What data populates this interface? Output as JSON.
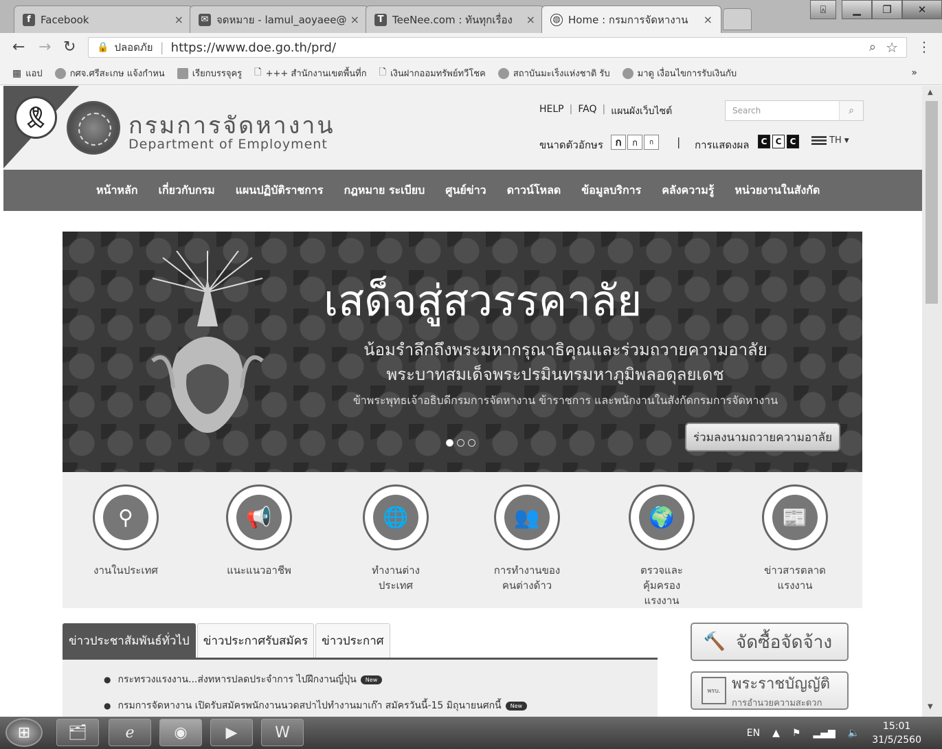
{
  "browser": {
    "tabs": [
      {
        "title": "Facebook",
        "favicon": "f",
        "active": false
      },
      {
        "title": "จดหมาย - lamul_aoyaee@",
        "favicon": "m",
        "active": false
      },
      {
        "title": "TeeNee.com : ทันทุกเรื่อง",
        "favicon": "t",
        "active": false
      },
      {
        "title": "Home : กรมการจัดหางาน",
        "favicon": "globe",
        "active": true
      }
    ],
    "secure_label": "ปลอดภัย",
    "url": "https://www.doe.go.th/prd/",
    "bookmarks": [
      "แอป",
      "กศจ.ศรีสะเกษ แจ้งกำหน",
      "เรียกบรรจุครู",
      "+++ สำนักงานเขตพื้นที่ก",
      "เงินฝากออมทรัพย์ทวีโชค",
      "สถาบันมะเร็งแห่งชาติ รับ",
      "มาดู เงื่อนไขการรับเงินกับ"
    ],
    "bookmarks_more": "»"
  },
  "site": {
    "name_th": "กรมการจัดหางาน",
    "name_en": "Department of Employment",
    "toplinks": [
      "HELP",
      "FAQ",
      "แผนผังเว็บไซต์"
    ],
    "search_placeholder": "Search",
    "font_size_label": "ขนาดตัวอักษร",
    "font_size_buttons": [
      "ก",
      "ก",
      "ก"
    ],
    "display_label": "การแสดงผล",
    "display_buttons": [
      "C",
      "C",
      "C"
    ],
    "language": "TH",
    "nav": [
      "หน้าหลัก",
      "เกี่ยวกับกรม",
      "แผนปฏิบัติราชการ",
      "กฎหมาย ระเบียบ",
      "ศูนย์ข่าว",
      "ดาวน์โหลด",
      "ข้อมูลบริการ",
      "คลังความรู้",
      "หน่วยงานในสังกัด"
    ]
  },
  "banner": {
    "title": "เสด็จสู่สวรรคาลัย",
    "line1": "น้อมรำลึกถึงพระมหากรุณาธิคุณและร่วมถวายความอาลัย",
    "line2": "พระบาทสมเด็จพระปรมินทรมหาภูมิพลอดุลยเดช",
    "line3": "ข้าพระพุทธเจ้าอธิบดีกรมการจัดหางาน ข้าราชการ และพนักงานในสังกัดกรมการจัดหางาน",
    "button": "ร่วมลงนามถวายความอาลัย",
    "slides": 3,
    "active_slide": 1
  },
  "services": [
    {
      "label": "งานในประเทศ",
      "icon": "map-person-icon"
    },
    {
      "label": "แนะแนวอาชีพ",
      "icon": "megaphone-icon"
    },
    {
      "label": "ทำงานต่าง ประเทศ",
      "icon": "globe-person-icon"
    },
    {
      "label": "การทำงานของ คนต่างด้าว",
      "icon": "people-icon"
    },
    {
      "label": "ตรวจและ คุ้มครอง แรงงาน",
      "icon": "worker-globe-icon"
    },
    {
      "label": "ข่าวสารตลาด แรงงาน",
      "icon": "jobs-newspaper-icon"
    }
  ],
  "news_tabs": [
    "ข่าวประชาสัมพันธ์ทั่วไป",
    "ข่าวประกาศรับสมัคร",
    "ข่าวประกาศ"
  ],
  "news_items": [
    {
      "text": "กระทรวงแรงงาน...ส่งทหารปลดประจำการ ไปฝึกงานญี่ปุ่น",
      "badge": "New"
    },
    {
      "text": "กรมการจัดหางาน เปิดรับสมัครพนักงานนวดสปาไปทำงานมาเก๊า สมัครวันนี้-15 มิถุนายนศกนี้",
      "badge": "New"
    }
  ],
  "side_buttons": {
    "procurement": "จัดซื้อจัดจ้าง",
    "act_title": "พระราชบัญญัติ",
    "act_sub": "การอำนวยความสะดวก",
    "act_icon_text": "พรบ."
  },
  "taskbar": {
    "lang": "EN",
    "time": "15:01",
    "date": "31/5/2560"
  }
}
